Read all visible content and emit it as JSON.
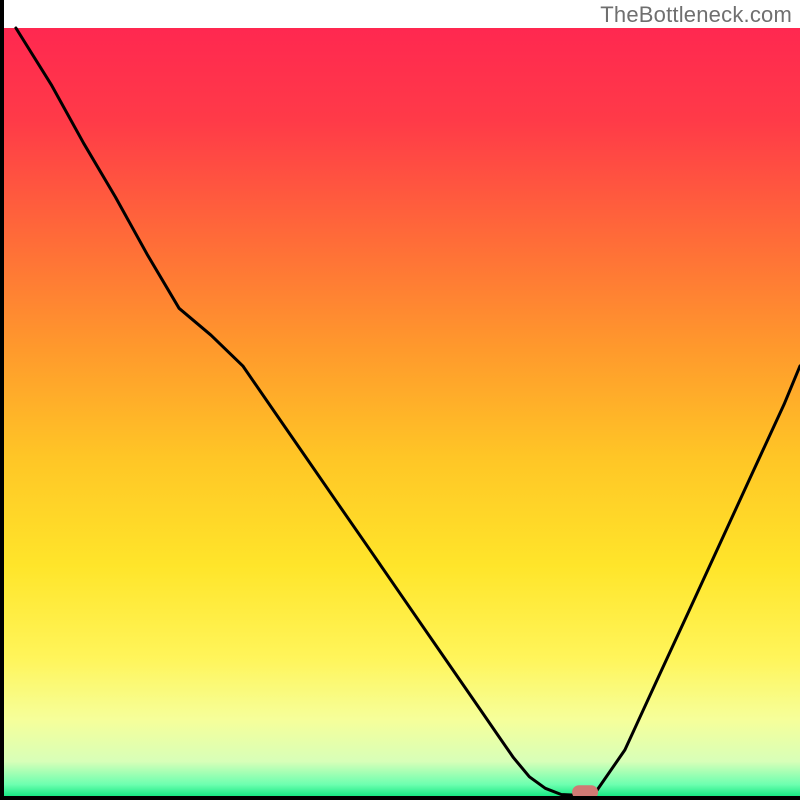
{
  "watermark": "TheBottleneck.com",
  "chart_data": {
    "type": "line",
    "title": "",
    "xlabel": "",
    "ylabel": "",
    "xlim": [
      0,
      100
    ],
    "ylim": [
      0,
      100
    ],
    "x": [
      1.5,
      6,
      10,
      14,
      18,
      22,
      26,
      30,
      34,
      38,
      42,
      46,
      50,
      54,
      58,
      60,
      62,
      64,
      66,
      68,
      70,
      74,
      78,
      82,
      86,
      90,
      94,
      98,
      100
    ],
    "values": [
      100,
      92.5,
      85,
      78,
      70.5,
      63.5,
      60,
      56,
      50,
      44,
      38,
      32,
      26,
      20,
      14,
      11,
      8,
      5,
      2.5,
      1,
      0.2,
      0,
      6,
      15,
      24,
      33,
      42,
      51,
      56
    ],
    "marker": {
      "x": 73,
      "y": 0.5
    },
    "gradient_stops": [
      {
        "offset": 0.0,
        "color": "#ff2850"
      },
      {
        "offset": 0.12,
        "color": "#ff3a48"
      },
      {
        "offset": 0.28,
        "color": "#ff6d38"
      },
      {
        "offset": 0.42,
        "color": "#ff9a2c"
      },
      {
        "offset": 0.56,
        "color": "#ffc626"
      },
      {
        "offset": 0.7,
        "color": "#ffe52a"
      },
      {
        "offset": 0.82,
        "color": "#fff55a"
      },
      {
        "offset": 0.9,
        "color": "#f6ff9a"
      },
      {
        "offset": 0.955,
        "color": "#d8ffb8"
      },
      {
        "offset": 0.985,
        "color": "#6dffb0"
      },
      {
        "offset": 1.0,
        "color": "#19e884"
      }
    ]
  }
}
